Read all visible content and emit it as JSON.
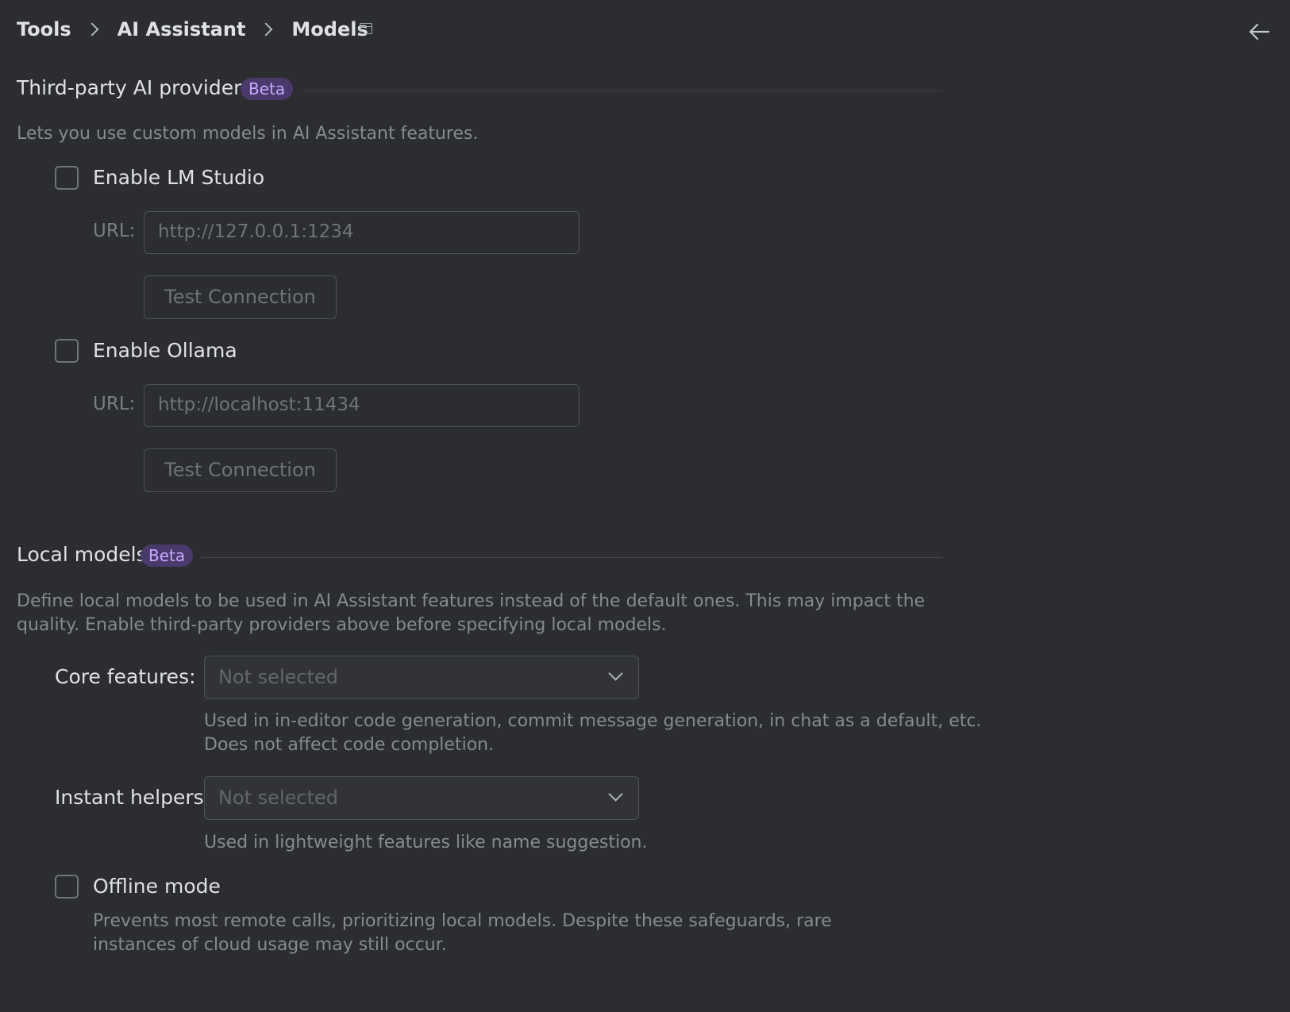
{
  "breadcrumb": {
    "items": [
      "Tools",
      "AI Assistant",
      "Models"
    ]
  },
  "third_party": {
    "title": "Third-party AI providers",
    "badge": "Beta",
    "description": "Lets you use custom models in AI Assistant features.",
    "lm_studio": {
      "label": "Enable LM Studio",
      "checked": false,
      "url_label": "URL:",
      "url_placeholder": "http://127.0.0.1:1234",
      "test_label": "Test Connection"
    },
    "ollama": {
      "label": "Enable Ollama",
      "checked": false,
      "url_label": "URL:",
      "url_placeholder": "http://localhost:11434",
      "test_label": "Test Connection"
    }
  },
  "local_models": {
    "title": "Local models",
    "badge": "Beta",
    "description_line1": "Define local models to be used in AI Assistant features instead of the default ones. This may impact the",
    "description_line2": "quality. Enable third-party providers above before specifying local models.",
    "core_features": {
      "label": "Core features:",
      "value": "Not selected",
      "hint_line1": "Used in in-editor code generation, commit message generation, in chat as a default, etc.",
      "hint_line2": "Does not affect code completion."
    },
    "instant_helpers": {
      "label": "Instant helpers:",
      "value": "Not selected",
      "hint": "Used in lightweight features like name suggestion."
    },
    "offline_mode": {
      "label": "Offline mode",
      "checked": false,
      "hint_line1": "Prevents most remote calls, prioritizing local models. Despite these safeguards, rare",
      "hint_line2": "instances of cloud usage may still occur."
    }
  },
  "icons": {
    "window": "window-icon",
    "back": "arrow-left-icon",
    "separator": "chevron-right-icon",
    "dropdown": "chevron-down-icon"
  },
  "colors": {
    "background": "#2b2d30",
    "badge_bg": "#4a3a6b",
    "badge_text": "#c9a9ff"
  }
}
